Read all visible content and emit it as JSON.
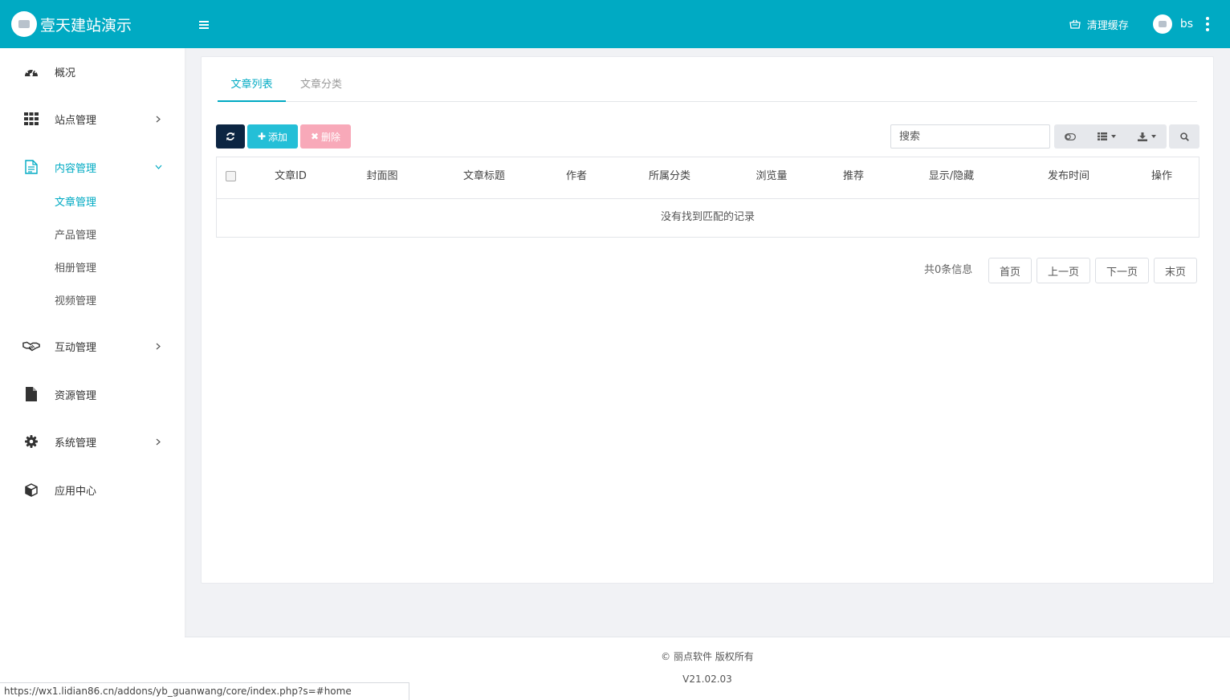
{
  "header": {
    "brand_title": "壹天建站演示",
    "clear_cache_label": "清理缓存",
    "username": "bs",
    "accent_color": "#00aac3"
  },
  "sidebar": {
    "items": [
      {
        "label": "概况",
        "icon": "dashboard-icon"
      },
      {
        "label": "站点管理",
        "icon": "grid-icon",
        "expandable": true
      },
      {
        "label": "内容管理",
        "icon": "document-icon",
        "expanded": true
      },
      {
        "label": "互动管理",
        "icon": "handshake-icon",
        "expandable": true
      },
      {
        "label": "资源管理",
        "icon": "file-icon"
      },
      {
        "label": "系统管理",
        "icon": "gear-icon",
        "expandable": true
      },
      {
        "label": "应用中心",
        "icon": "cube-icon"
      }
    ],
    "sub_items": [
      {
        "label": "文章管理",
        "active": true
      },
      {
        "label": "产品管理"
      },
      {
        "label": "相册管理"
      },
      {
        "label": "视频管理"
      }
    ]
  },
  "main": {
    "tabs": [
      {
        "label": "文章列表",
        "active": true
      },
      {
        "label": "文章分类"
      }
    ],
    "toolbar": {
      "add_label": "添加",
      "delete_label": "删除",
      "search_placeholder": "搜索"
    },
    "table": {
      "columns": [
        "文章ID",
        "封面图",
        "文章标题",
        "作者",
        "所属分类",
        "浏览量",
        "推荐",
        "显示/隐藏",
        "发布时间",
        "操作"
      ],
      "empty_message": "没有找到匹配的记录"
    },
    "pagination": {
      "total_text": "共0条信息",
      "first": "首页",
      "prev": "上一页",
      "next": "下一页",
      "last": "末页"
    }
  },
  "footer": {
    "copyright": "© 丽点软件 版权所有",
    "version": "V21.02.03"
  },
  "status_bar": {
    "url": "https://wx1.lidian86.cn/addons/yb_guanwang/core/index.php?s=#home"
  }
}
